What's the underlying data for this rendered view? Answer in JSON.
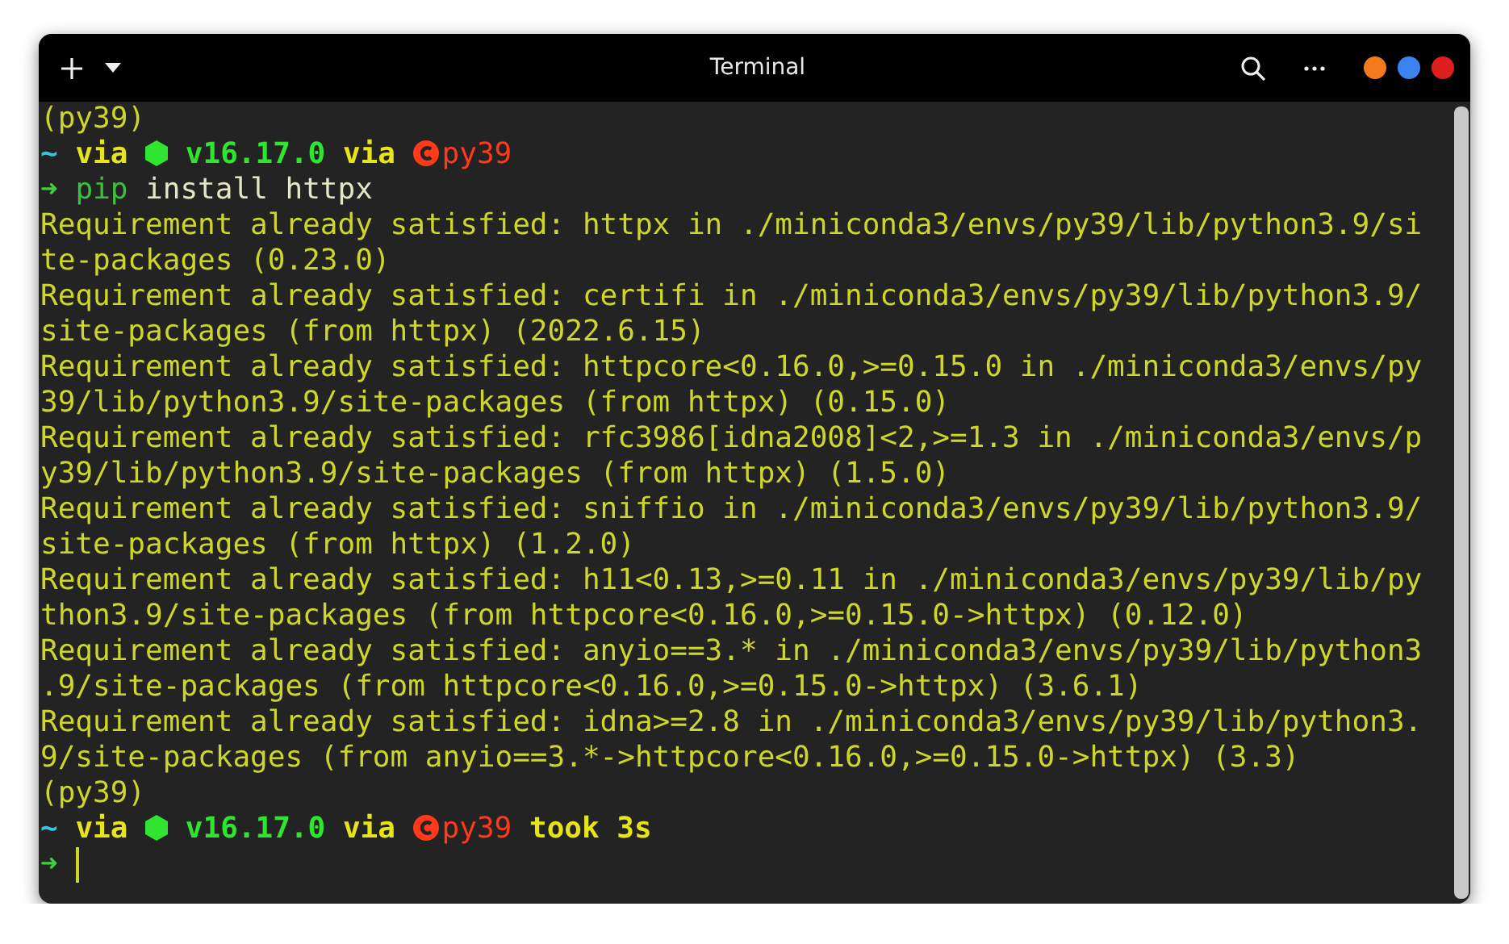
{
  "window": {
    "title": "Terminal"
  },
  "lines": [
    {
      "segments": [
        {
          "kind": "output",
          "text": "(py39)"
        }
      ]
    },
    {
      "segments": [
        {
          "kind": "tilde",
          "text": "~"
        },
        {
          "kind": "keyword",
          "text": "via"
        },
        {
          "kind": "node-icon"
        },
        {
          "kind": "version",
          "text": "v16.17.0"
        },
        {
          "kind": "keyword",
          "text": "via"
        },
        {
          "kind": "python-icon"
        },
        {
          "kind": "env",
          "text": "py39"
        }
      ]
    },
    {
      "segments": [
        {
          "kind": "arrow",
          "text": "➜"
        },
        {
          "kind": "command",
          "text": "pip"
        },
        {
          "kind": "args",
          "text": "install httpx"
        }
      ]
    },
    {
      "segments": [
        {
          "kind": "output",
          "text": "Requirement already satisfied: httpx in ./miniconda3/envs/py39/lib/python3.9/si"
        }
      ]
    },
    {
      "segments": [
        {
          "kind": "output",
          "text": "te-packages (0.23.0)"
        }
      ]
    },
    {
      "segments": [
        {
          "kind": "output",
          "text": "Requirement already satisfied: certifi in ./miniconda3/envs/py39/lib/python3.9/"
        }
      ]
    },
    {
      "segments": [
        {
          "kind": "output",
          "text": "site-packages (from httpx) (2022.6.15)"
        }
      ]
    },
    {
      "segments": [
        {
          "kind": "output",
          "text": "Requirement already satisfied: httpcore<0.16.0,>=0.15.0 in ./miniconda3/envs/py"
        }
      ]
    },
    {
      "segments": [
        {
          "kind": "output",
          "text": "39/lib/python3.9/site-packages (from httpx) (0.15.0)"
        }
      ]
    },
    {
      "segments": [
        {
          "kind": "output",
          "text": "Requirement already satisfied: rfc3986[idna2008]<2,>=1.3 in ./miniconda3/envs/p"
        }
      ]
    },
    {
      "segments": [
        {
          "kind": "output",
          "text": "y39/lib/python3.9/site-packages (from httpx) (1.5.0)"
        }
      ]
    },
    {
      "segments": [
        {
          "kind": "output",
          "text": "Requirement already satisfied: sniffio in ./miniconda3/envs/py39/lib/python3.9/"
        }
      ]
    },
    {
      "segments": [
        {
          "kind": "output",
          "text": "site-packages (from httpx) (1.2.0)"
        }
      ]
    },
    {
      "segments": [
        {
          "kind": "output",
          "text": "Requirement already satisfied: h11<0.13,>=0.11 in ./miniconda3/envs/py39/lib/py"
        }
      ]
    },
    {
      "segments": [
        {
          "kind": "output",
          "text": "thon3.9/site-packages (from httpcore<0.16.0,>=0.15.0->httpx) (0.12.0)"
        }
      ]
    },
    {
      "segments": [
        {
          "kind": "output",
          "text": "Requirement already satisfied: anyio==3.* in ./miniconda3/envs/py39/lib/python3"
        }
      ]
    },
    {
      "segments": [
        {
          "kind": "output",
          "text": ".9/site-packages (from httpcore<0.16.0,>=0.15.0->httpx) (3.6.1)"
        }
      ]
    },
    {
      "segments": [
        {
          "kind": "output",
          "text": "Requirement already satisfied: idna>=2.8 in ./miniconda3/envs/py39/lib/python3."
        }
      ]
    },
    {
      "segments": [
        {
          "kind": "output",
          "text": "9/site-packages (from anyio==3.*->httpcore<0.16.0,>=0.15.0->httpx) (3.3)"
        }
      ]
    },
    {
      "segments": [
        {
          "kind": "output",
          "text": "(py39)"
        }
      ]
    },
    {
      "segments": [
        {
          "kind": "tilde",
          "text": "~"
        },
        {
          "kind": "keyword",
          "text": "via"
        },
        {
          "kind": "node-icon"
        },
        {
          "kind": "version",
          "text": "v16.17.0"
        },
        {
          "kind": "keyword",
          "text": "via"
        },
        {
          "kind": "python-icon"
        },
        {
          "kind": "env",
          "text": "py39"
        },
        {
          "kind": "took",
          "text": "took 3s"
        }
      ]
    },
    {
      "segments": [
        {
          "kind": "arrow",
          "text": "➜"
        },
        {
          "kind": "cursor"
        }
      ]
    }
  ]
}
